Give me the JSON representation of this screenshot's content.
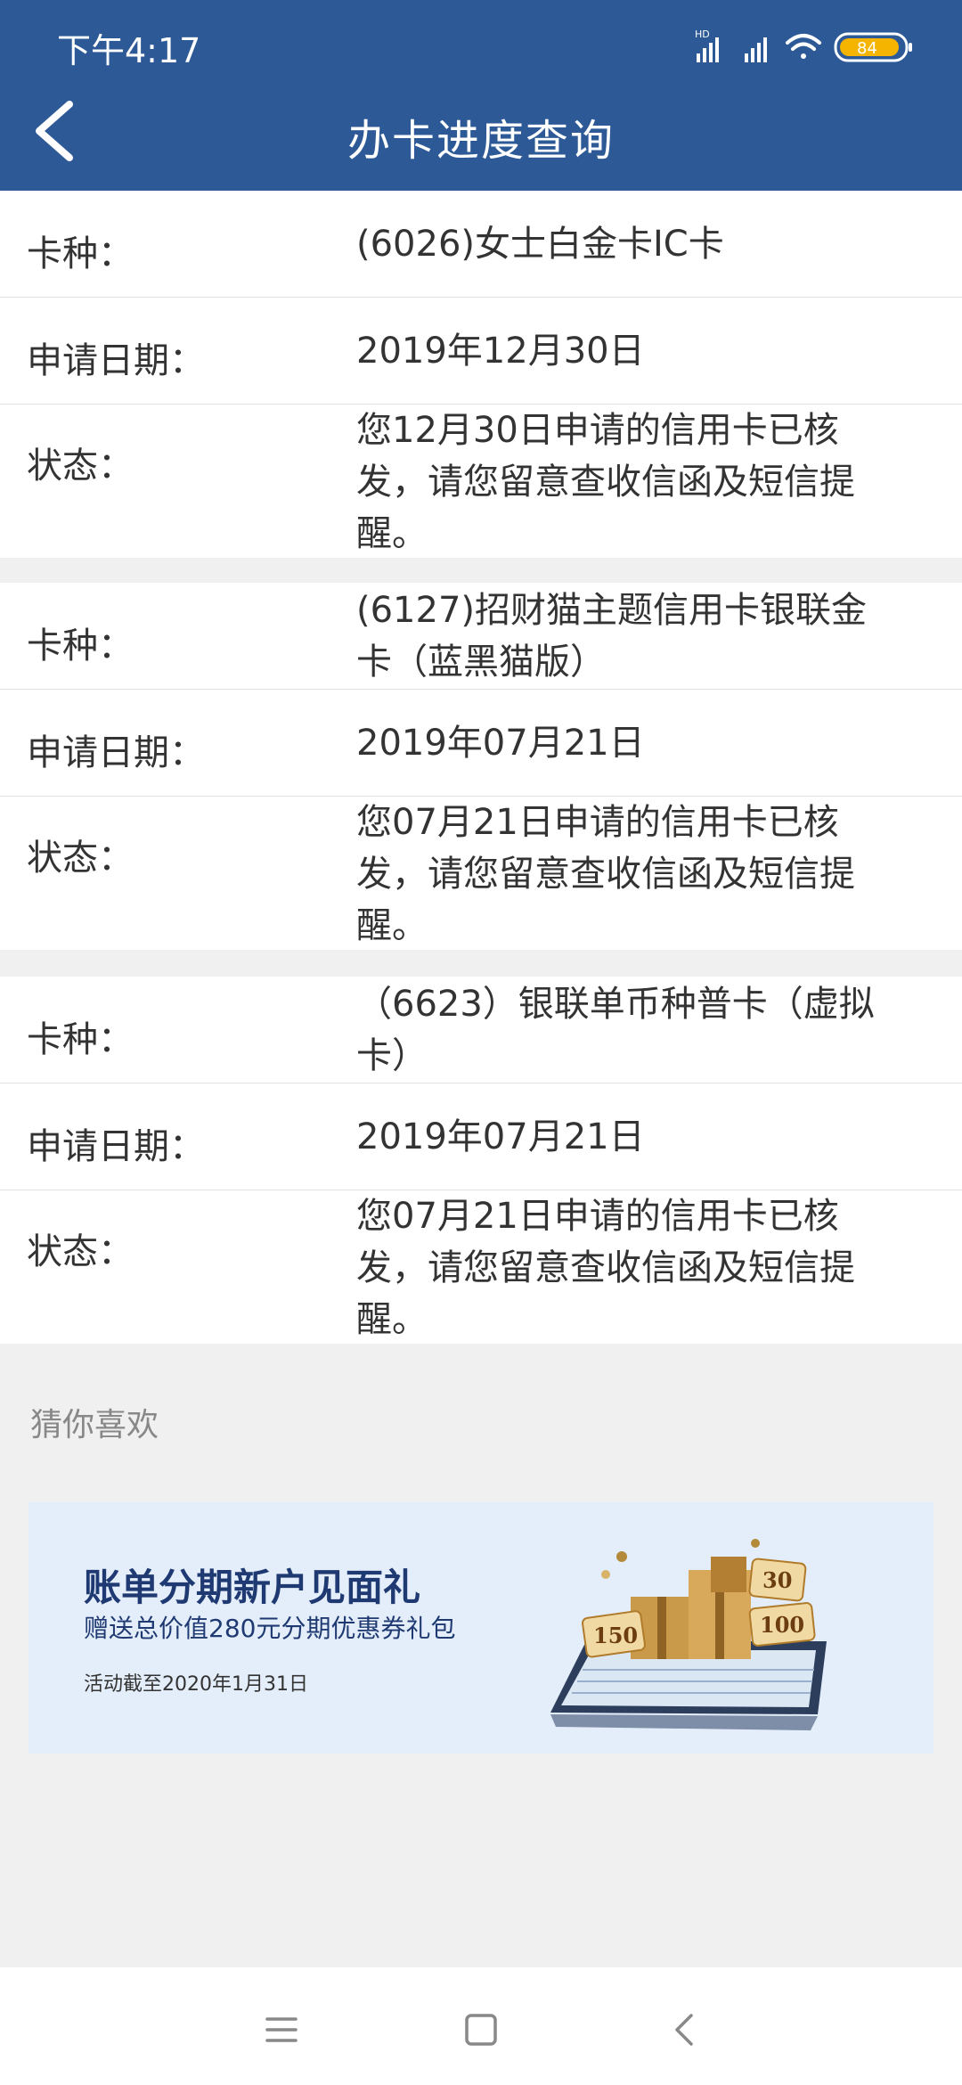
{
  "status_bar": {
    "time": "下午4:17",
    "battery": "84"
  },
  "header": {
    "title": "办卡进度查询"
  },
  "labels": {
    "card_type": "卡种：",
    "apply_date": "申请日期：",
    "status": "状态："
  },
  "applications": [
    {
      "card_type": "(6026)女士白金卡IC卡",
      "apply_date": "2019年12月30日",
      "status": "您12月30日申请的信用卡已核发，请您留意查收信函及短信提醒。"
    },
    {
      "card_type": "(6127)招财猫主题信用卡银联金卡（蓝黑猫版）",
      "apply_date": "2019年07月21日",
      "status": "您07月21日申请的信用卡已核发，请您留意查收信函及短信提醒。"
    },
    {
      "card_type": "（6623）银联单币种普卡（虚拟卡）",
      "apply_date": "2019年07月21日",
      "status": "您07月21日申请的信用卡已核发，请您留意查收信函及短信提醒。"
    }
  ],
  "recommend": {
    "title": "猜你喜欢",
    "banner": {
      "title": "账单分期新户见面礼",
      "subtitle": "赠送总价值280元分期优惠券礼包",
      "note": "活动截至2020年1月31日",
      "coupons": [
        "150",
        "30",
        "100"
      ]
    }
  },
  "icons": {
    "back": "back-arrow-icon",
    "menu": "menu-icon",
    "home": "home-icon",
    "nav_back": "nav-back-icon"
  },
  "colors": {
    "header_bg": "#2d5a97",
    "banner_bg": "#e4eefa"
  }
}
